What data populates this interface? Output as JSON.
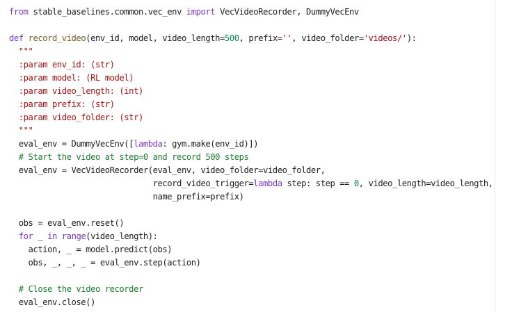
{
  "colors": {
    "background": "#ffffff",
    "text": "#212121",
    "keyword": "#7d3cbf",
    "function": "#795e26",
    "string": "#a31515",
    "number": "#098658",
    "comment": "#1e7d32"
  },
  "code": {
    "lines": [
      [
        {
          "t": "from",
          "c": "kw"
        },
        {
          "t": " stable_baselines.common.vec_env "
        },
        {
          "t": "import",
          "c": "kw"
        },
        {
          "t": " VecVideoRecorder, DummyVecEnv"
        }
      ],
      [],
      [
        {
          "t": "def",
          "c": "kw"
        },
        {
          "t": " "
        },
        {
          "t": "record_video",
          "c": "fn"
        },
        {
          "t": "(env_id, model, video_length="
        },
        {
          "t": "500",
          "c": "num"
        },
        {
          "t": ", prefix="
        },
        {
          "t": "''",
          "c": "str"
        },
        {
          "t": ", video_folder="
        },
        {
          "t": "'videos/'",
          "c": "str"
        },
        {
          "t": "):"
        }
      ],
      [
        {
          "t": "  \"\"\"",
          "c": "str"
        }
      ],
      [
        {
          "t": "  :param env_id: (str)",
          "c": "str"
        }
      ],
      [
        {
          "t": "  :param model: (RL model)",
          "c": "str"
        }
      ],
      [
        {
          "t": "  :param video_length: (int)",
          "c": "str"
        }
      ],
      [
        {
          "t": "  :param prefix: (str)",
          "c": "str"
        }
      ],
      [
        {
          "t": "  :param video_folder: (str)",
          "c": "str"
        }
      ],
      [
        {
          "t": "  \"\"\"",
          "c": "str"
        }
      ],
      [
        {
          "t": "  eval_env = DummyVecEnv(["
        },
        {
          "t": "lambda",
          "c": "kw"
        },
        {
          "t": ": gym.make(env_id)])"
        }
      ],
      [
        {
          "t": "  # Start the video at step=0 and record 500 steps",
          "c": "cm"
        }
      ],
      [
        {
          "t": "  eval_env = VecVideoRecorder(eval_env, video_folder=video_folder,"
        }
      ],
      [
        {
          "t": "                              record_video_trigger="
        },
        {
          "t": "lambda",
          "c": "kw"
        },
        {
          "t": " step: step == "
        },
        {
          "t": "0",
          "c": "num"
        },
        {
          "t": ", video_length=video_length,"
        }
      ],
      [
        {
          "t": "                              name_prefix=prefix)"
        }
      ],
      [],
      [
        {
          "t": "  obs = eval_env.reset()"
        }
      ],
      [
        {
          "t": "  "
        },
        {
          "t": "for",
          "c": "kw"
        },
        {
          "t": " _ "
        },
        {
          "t": "in",
          "c": "kw"
        },
        {
          "t": " "
        },
        {
          "t": "range",
          "c": "bi"
        },
        {
          "t": "(video_length):"
        }
      ],
      [
        {
          "t": "    action, _ = model.predict(obs)"
        }
      ],
      [
        {
          "t": "    obs, _, _, _ = eval_env.step(action)"
        }
      ],
      [],
      [
        {
          "t": "  # Close the video recorder",
          "c": "cm"
        }
      ],
      [
        {
          "t": "  eval_env.close()"
        }
      ]
    ]
  }
}
